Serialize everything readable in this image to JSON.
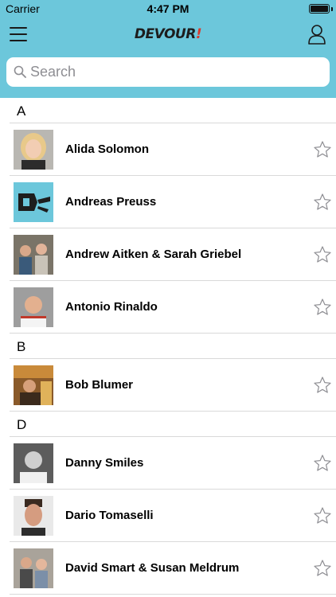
{
  "status_bar": {
    "carrier": "Carrier",
    "time": "4:47 PM"
  },
  "nav": {
    "logo_main": "DEVOUR",
    "logo_bang": "!"
  },
  "search": {
    "placeholder": "Search"
  },
  "colors": {
    "header_bg": "#6cc7db",
    "separator": "#d9d9d9",
    "star_outline": "#8e8e93"
  },
  "sections": [
    {
      "letter": "A",
      "people": [
        {
          "name": "Alida Solomon",
          "avatar": "portrait-blonde-woman"
        },
        {
          "name": "Andreas Preuss",
          "avatar": "devour-logo-tile"
        },
        {
          "name": "Andrew Aitken & Sarah Griebel",
          "avatar": "two-chefs-in-kitchen"
        },
        {
          "name": "Antonio Rinaldo",
          "avatar": "smiling-man-portrait"
        }
      ]
    },
    {
      "letter": "B",
      "people": [
        {
          "name": "Bob Blumer",
          "avatar": "man-at-market"
        }
      ]
    },
    {
      "letter": "D",
      "people": [
        {
          "name": "Danny Smiles",
          "avatar": "black-and-white-chef"
        },
        {
          "name": "Dario Tomaselli",
          "avatar": "man-with-stubble"
        },
        {
          "name": "David Smart & Susan Meldrum",
          "avatar": "couple-in-kitchen"
        }
      ]
    }
  ]
}
